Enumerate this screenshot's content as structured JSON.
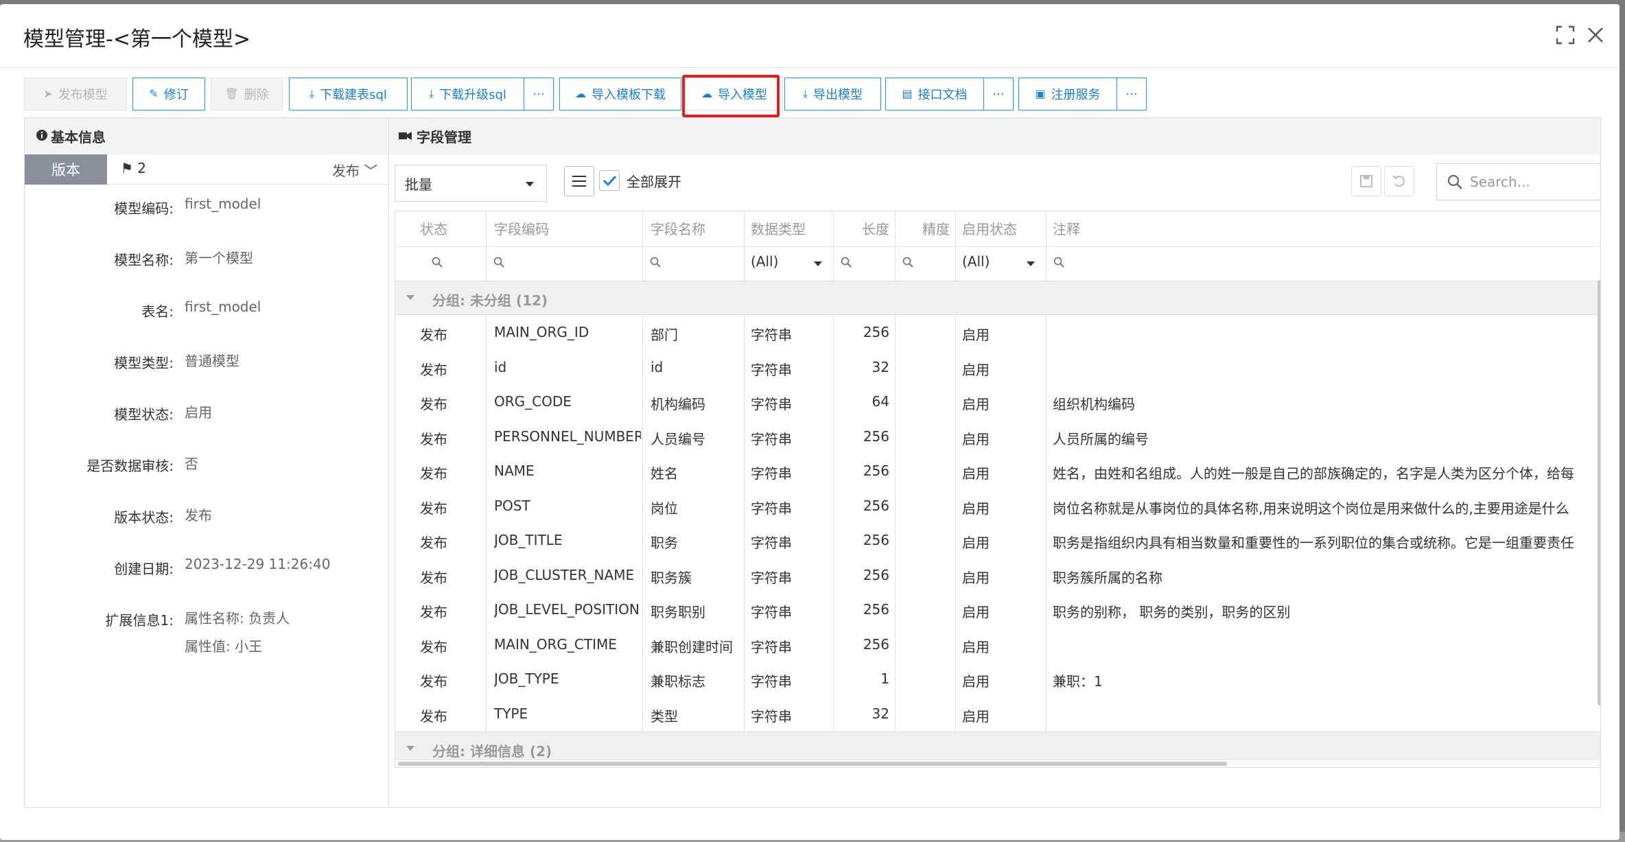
{
  "dialog": {
    "title": "模型管理-<第一个模型>"
  },
  "toolbar": {
    "publish": "发布模型",
    "edit": "修订",
    "delete": "删除",
    "download_create_sql": "下载建表sql",
    "download_upgrade_sql": "下载升级sql",
    "more": "···",
    "import_template_download": "导入模板下载",
    "import_model": "导入模型",
    "export_model": "导出模型",
    "api_doc": "接口文档",
    "register_service": "注册服务"
  },
  "left": {
    "title": "基本信息",
    "version_tab": "版本",
    "version_number": "2",
    "version_status": "发布",
    "fields": [
      {
        "label": "模型编码:",
        "value": "first_model"
      },
      {
        "label": "模型名称:",
        "value": "第一个模型"
      },
      {
        "label": "表名:",
        "value": "first_model"
      },
      {
        "label": "模型类型:",
        "value": "普通模型"
      },
      {
        "label": "模型状态:",
        "value": "启用"
      },
      {
        "label": "是否数据审核:",
        "value": "否"
      },
      {
        "label": "版本状态:",
        "value": "发布"
      },
      {
        "label": "创建日期:",
        "value": "2023-12-29 11:26:40"
      },
      {
        "label": "扩展信息1:",
        "value": "属性名称: 负责人",
        "value2": "属性值: 小王"
      }
    ]
  },
  "right": {
    "title": "字段管理",
    "batch_select": "批量",
    "expand_all": "全部展开",
    "search_placeholder": "Search...",
    "columns": [
      "状态",
      "字段编码",
      "字段名称",
      "数据类型",
      "长度",
      "精度",
      "启用状态",
      "注释"
    ],
    "filter_all": "(All)",
    "groups": [
      {
        "label": "分组: 未分组 (12)"
      },
      {
        "label": "分组: 详细信息 (2)"
      }
    ],
    "rows": [
      [
        "发布",
        "MAIN_ORG_ID",
        "部门",
        "字符串",
        "256",
        "",
        "启用",
        ""
      ],
      [
        "发布",
        "id",
        "id",
        "字符串",
        "32",
        "",
        "启用",
        ""
      ],
      [
        "发布",
        "ORG_CODE",
        "机构编码",
        "字符串",
        "64",
        "",
        "启用",
        "组织机构编码"
      ],
      [
        "发布",
        "PERSONNEL_NUMBER",
        "人员编号",
        "字符串",
        "256",
        "",
        "启用",
        "人员所属的编号"
      ],
      [
        "发布",
        "NAME",
        "姓名",
        "字符串",
        "256",
        "",
        "启用",
        "姓名，由姓和名组成。人的姓一般是自己的部族确定的，名字是人类为区分个体，给每"
      ],
      [
        "发布",
        "POST",
        "岗位",
        "字符串",
        "256",
        "",
        "启用",
        "岗位名称就是从事岗位的具体名称,用来说明这个岗位是用来做什么的,主要用途是什么"
      ],
      [
        "发布",
        "JOB_TITLE",
        "职务",
        "字符串",
        "256",
        "",
        "启用",
        "职务是指组织内具有相当数量和重要性的一系列职位的集合或统称。它是一组重要责任"
      ],
      [
        "发布",
        "JOB_CLUSTER_NAME",
        "职务簇",
        "字符串",
        "256",
        "",
        "启用",
        "职务簇所属的名称"
      ],
      [
        "发布",
        "JOB_LEVEL_POSITION",
        "职务职别",
        "字符串",
        "256",
        "",
        "启用",
        "职务的别称， 职务的类别，职务的区别"
      ],
      [
        "发布",
        "MAIN_ORG_CTIME",
        "兼职创建时间",
        "字符串",
        "256",
        "",
        "启用",
        ""
      ],
      [
        "发布",
        "JOB_TYPE",
        "兼职标志",
        "字符串",
        "1",
        "",
        "启用",
        "兼职：1"
      ],
      [
        "发布",
        "TYPE",
        "类型",
        "字符串",
        "32",
        "",
        "启用",
        ""
      ]
    ]
  }
}
